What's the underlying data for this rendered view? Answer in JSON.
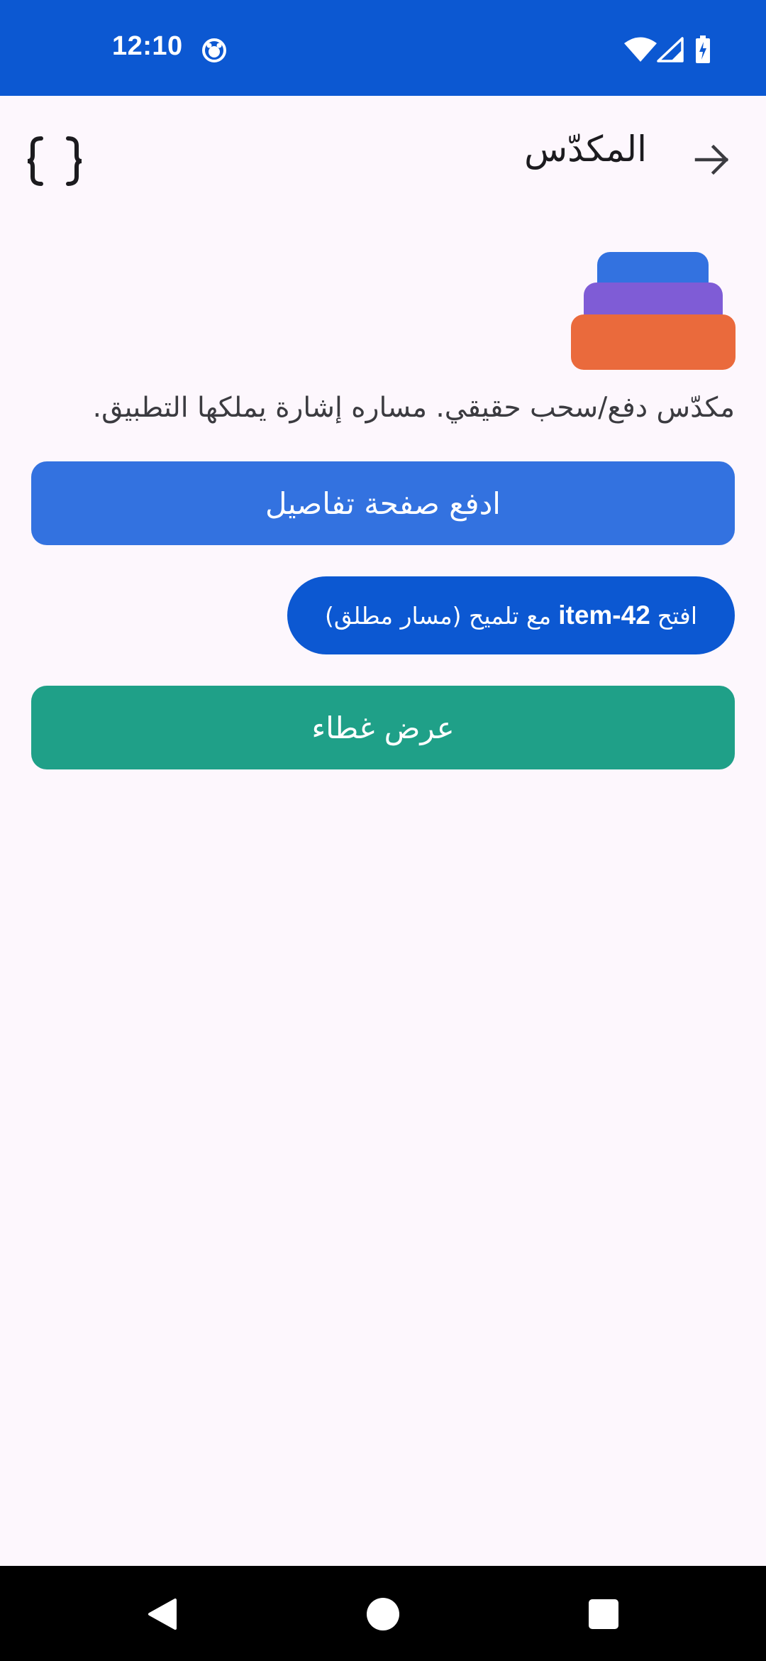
{
  "status_bar": {
    "time": "12:10",
    "bg_color": "#0c58d2",
    "icons": [
      "notification-icon",
      "wifi-icon",
      "signal-icon",
      "battery-charging-icon"
    ]
  },
  "app_bar": {
    "title": "المكدّس",
    "back_icon": "arrow-right-icon",
    "action_icon": "code-braces-icon"
  },
  "main": {
    "logo_icon": "stack-layers-icon",
    "description": "مكدّس دفع/سحب حقيقي. مساره إشارة يملكها التطبيق.",
    "push_button": {
      "label": "ادفع صفحة تفاصيل",
      "color": "#3372e0"
    },
    "open_button": {
      "prefix": "افتح",
      "item_id": "item-42",
      "suffix": "مع تلميح (مسار مطلق)",
      "color": "#0c58d2"
    },
    "overlay_button": {
      "label": "عرض غطاء",
      "color": "#1fa088"
    }
  },
  "nav_bar": {
    "icons": [
      "back-triangle-icon",
      "home-circle-icon",
      "recents-square-icon"
    ]
  }
}
